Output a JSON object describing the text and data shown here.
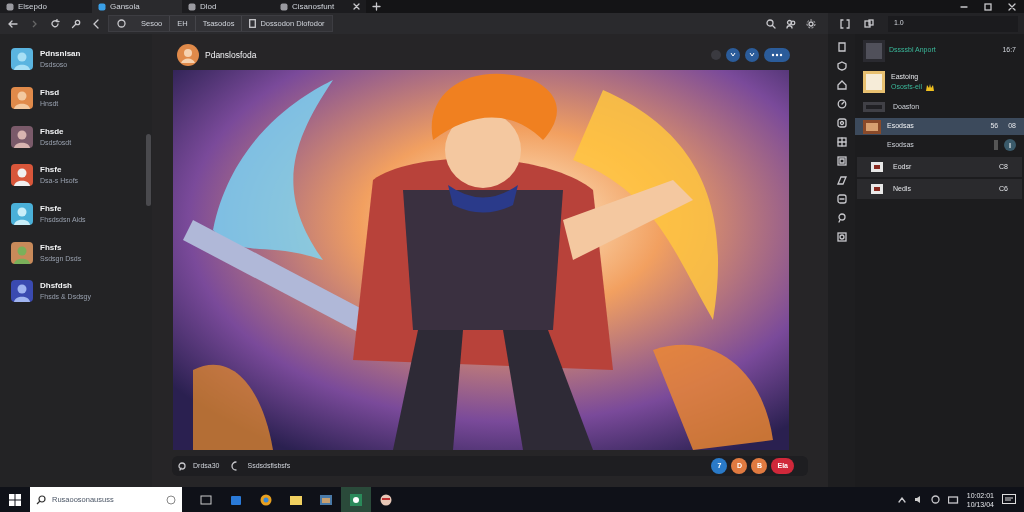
{
  "browser_tabs": [
    {
      "label": "Elsepdo",
      "selected": false
    },
    {
      "label": "Gansola",
      "selected": true
    },
    {
      "label": "Dlod",
      "selected": false
    },
    {
      "label": "Cisanosfunt",
      "selected": false,
      "closable": true
    }
  ],
  "toolbar": {
    "address_segments": [
      "Sesoo",
      "EH",
      "Tsasodos",
      "Dossodon Dlofodor"
    ],
    "panel_field": "1.0"
  },
  "sidebar": {
    "items": [
      {
        "title": "Pdnsnlsan",
        "subtitle": "Dsdsoso"
      },
      {
        "title": "Fhsd",
        "subtitle": "Hnsdt"
      },
      {
        "title": "Fhsde",
        "subtitle": "Dsdsfosdt"
      },
      {
        "title": "Fhsfe",
        "subtitle": "Dsa-s Hsofs"
      },
      {
        "title": "Fhsfe",
        "subtitle": "Fhsdsdsn Aids"
      },
      {
        "title": "Fhsfs",
        "subtitle": "Ssdsgn Dsds"
      },
      {
        "title": "Dhsfdsh",
        "subtitle": "Fhsds & Dsdsgy"
      }
    ]
  },
  "post": {
    "author": "Pdanslosfoda",
    "footer_left": "Drdsa30",
    "footer_status": "Ssdsdsfisbsfs",
    "actions": [
      {
        "label": "7",
        "kind": "blue"
      },
      {
        "label": "D",
        "kind": "orange"
      },
      {
        "label": "B",
        "kind": "orange"
      },
      {
        "label": "Ela",
        "kind": "red"
      }
    ]
  },
  "panel": {
    "items": [
      {
        "title": "Dssssbl Anport",
        "meta": "16:7",
        "kind": "accent"
      },
      {
        "title": "Eastoing",
        "subtitle": "Ososfs-eil",
        "kind": "crown"
      },
      {
        "title": "Doasfon",
        "kind": "plain"
      },
      {
        "title": "Esodsas",
        "meta": "56",
        "meta2": "08",
        "kind": "selected"
      },
      {
        "title": "Esodsas",
        "kind": "toggle"
      },
      {
        "title": "Eodsr",
        "meta": "C8",
        "kind": "boxed"
      },
      {
        "title": "Nedls",
        "meta": "C6",
        "kind": "boxed"
      }
    ]
  },
  "taskbar": {
    "search_placeholder": "Rusaoosonaususs",
    "clock_time": "10:02:01",
    "clock_date": "10/13/04"
  }
}
